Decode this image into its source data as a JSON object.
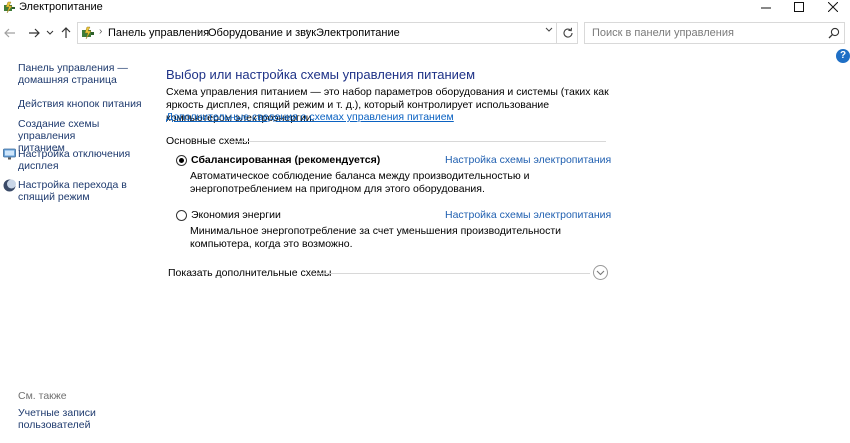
{
  "window": {
    "title": "Электропитание"
  },
  "navigation": {
    "breadcrumbs": [
      "Панель управления",
      "Оборудование и звук",
      "Электропитание"
    ],
    "search_placeholder": "Поиск в панели управления"
  },
  "sidebar": {
    "links": [
      {
        "label": "Панель управления —\nдомашняя страница",
        "icon": null
      },
      {
        "label": "Действия кнопок питания",
        "icon": null
      },
      {
        "label": "Создание схемы управления\nпитанием",
        "icon": null
      },
      {
        "label": "Настройка отключения\nдисплея",
        "icon": "display-icon"
      },
      {
        "label": "Настройка перехода в\nспящий режим",
        "icon": "moon-icon"
      }
    ],
    "see_also_title": "См. также",
    "see_also_links": [
      "Учетные записи\nпользователей"
    ]
  },
  "main": {
    "title": "Выбор или настройка схемы управления питанием",
    "description": "Схема управления питанием — это набор параметров оборудования и системы (таких как яркость дисплея, спящий режим и т. д.), который контролирует использование компьютером электроэнергии.",
    "more_info_link": "Дополнительные сведения о схемах управления питанием",
    "group_title": "Основные схемы",
    "plans": [
      {
        "name": "Сбалансированная (рекомендуется)",
        "selected": true,
        "settings_link": "Настройка схемы электропитания",
        "description": "Автоматическое соблюдение баланса между производительностью и энергопотреблением на пригодном для этого оборудования."
      },
      {
        "name": "Экономия энергии",
        "selected": false,
        "settings_link": "Настройка схемы электропитания",
        "description": "Минимальное энергопотребление за счет уменьшения производительности компьютера, когда это возможно."
      }
    ],
    "show_more": "Показать дополнительные схемы"
  },
  "colors": {
    "title_blue": "#1e3287",
    "link_blue": "#0b62c2",
    "help_blue": "#1f6fc5"
  }
}
